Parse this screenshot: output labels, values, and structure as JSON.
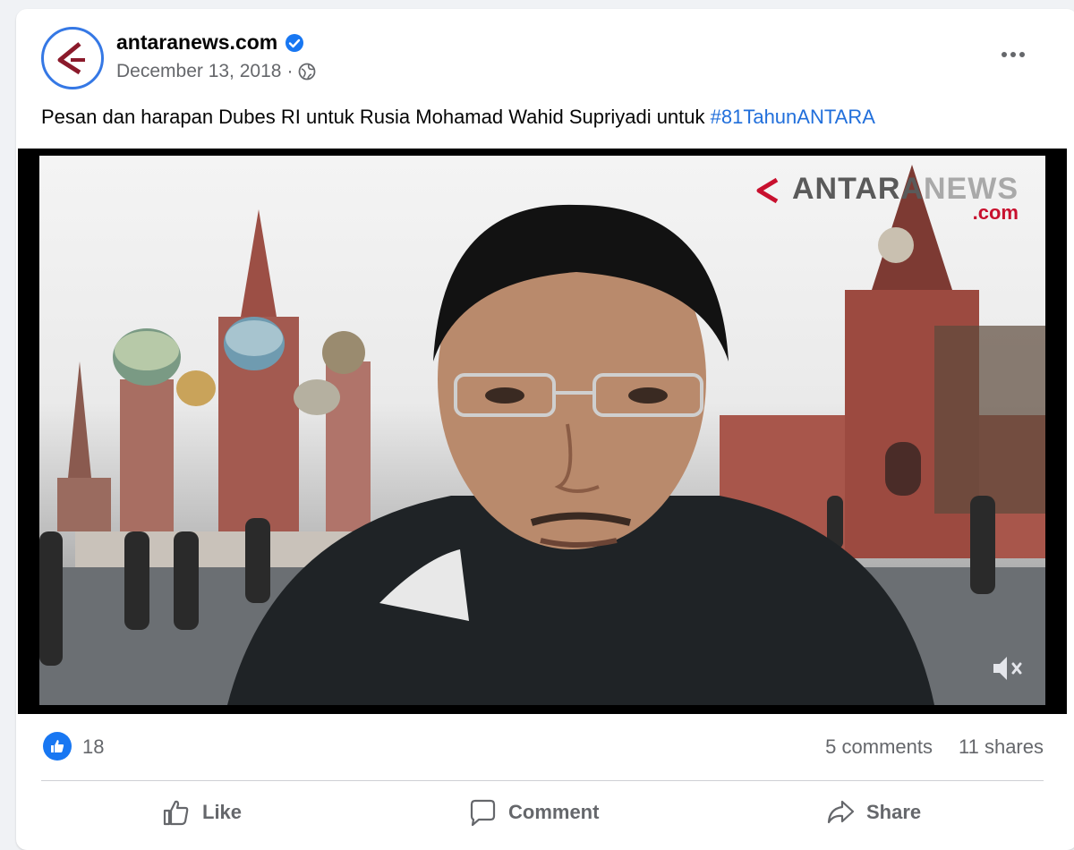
{
  "post": {
    "page_name": "antaranews.com",
    "date": "December 13, 2018",
    "separator": "·",
    "caption_text": "Pesan dan harapan Dubes RI untuk Rusia Mohamad Wahid Supriyadi untuk ",
    "hashtag": "#81TahunANTARA"
  },
  "video": {
    "watermark_main_dark": "ANTARA",
    "watermark_main_light": "NEWS",
    "watermark_sub": ".com"
  },
  "stats": {
    "likes": "18",
    "comments": "5 comments",
    "shares": "11 shares"
  },
  "actions": {
    "like": "Like",
    "comment": "Comment",
    "share": "Share"
  },
  "colors": {
    "accent": "#1877f2",
    "hashtag": "#216fdb",
    "brand_red": "#c8102e"
  },
  "icons": [
    "verified-badge-icon",
    "globe-icon",
    "more-options-icon",
    "mute-icon",
    "like-reaction-icon",
    "like-thumb-icon",
    "comment-bubble-icon",
    "share-arrow-icon"
  ]
}
